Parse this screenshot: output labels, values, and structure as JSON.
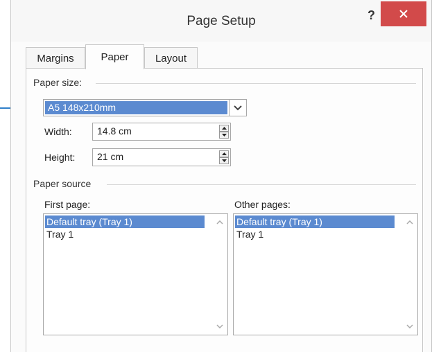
{
  "dialog": {
    "title": "Page Setup",
    "help_label": "?",
    "close_icon": "close-icon"
  },
  "tabs": [
    {
      "label": "Margins",
      "active": false
    },
    {
      "label": "Paper",
      "active": true
    },
    {
      "label": "Layout",
      "active": false
    }
  ],
  "paper_size": {
    "group_label": "Paper size:",
    "selected": "A5 148x210mm",
    "dropdown_icon": "chevron-down-icon",
    "width_label": "Width:",
    "width_value": "14.8 cm",
    "height_label": "Height:",
    "height_value": "21 cm"
  },
  "paper_source": {
    "group_label": "Paper source",
    "first_page_label": "First page:",
    "other_pages_label": "Other pages:",
    "first_page_items": [
      "Default tray (Tray 1)",
      "Tray 1"
    ],
    "other_pages_items": [
      "Default tray (Tray 1)",
      "Tray 1"
    ],
    "selected_index": 0
  },
  "colors": {
    "selection": "#5b8ad0",
    "close_button": "#d24a4a",
    "callout_arrow": "#2f7fc9"
  }
}
